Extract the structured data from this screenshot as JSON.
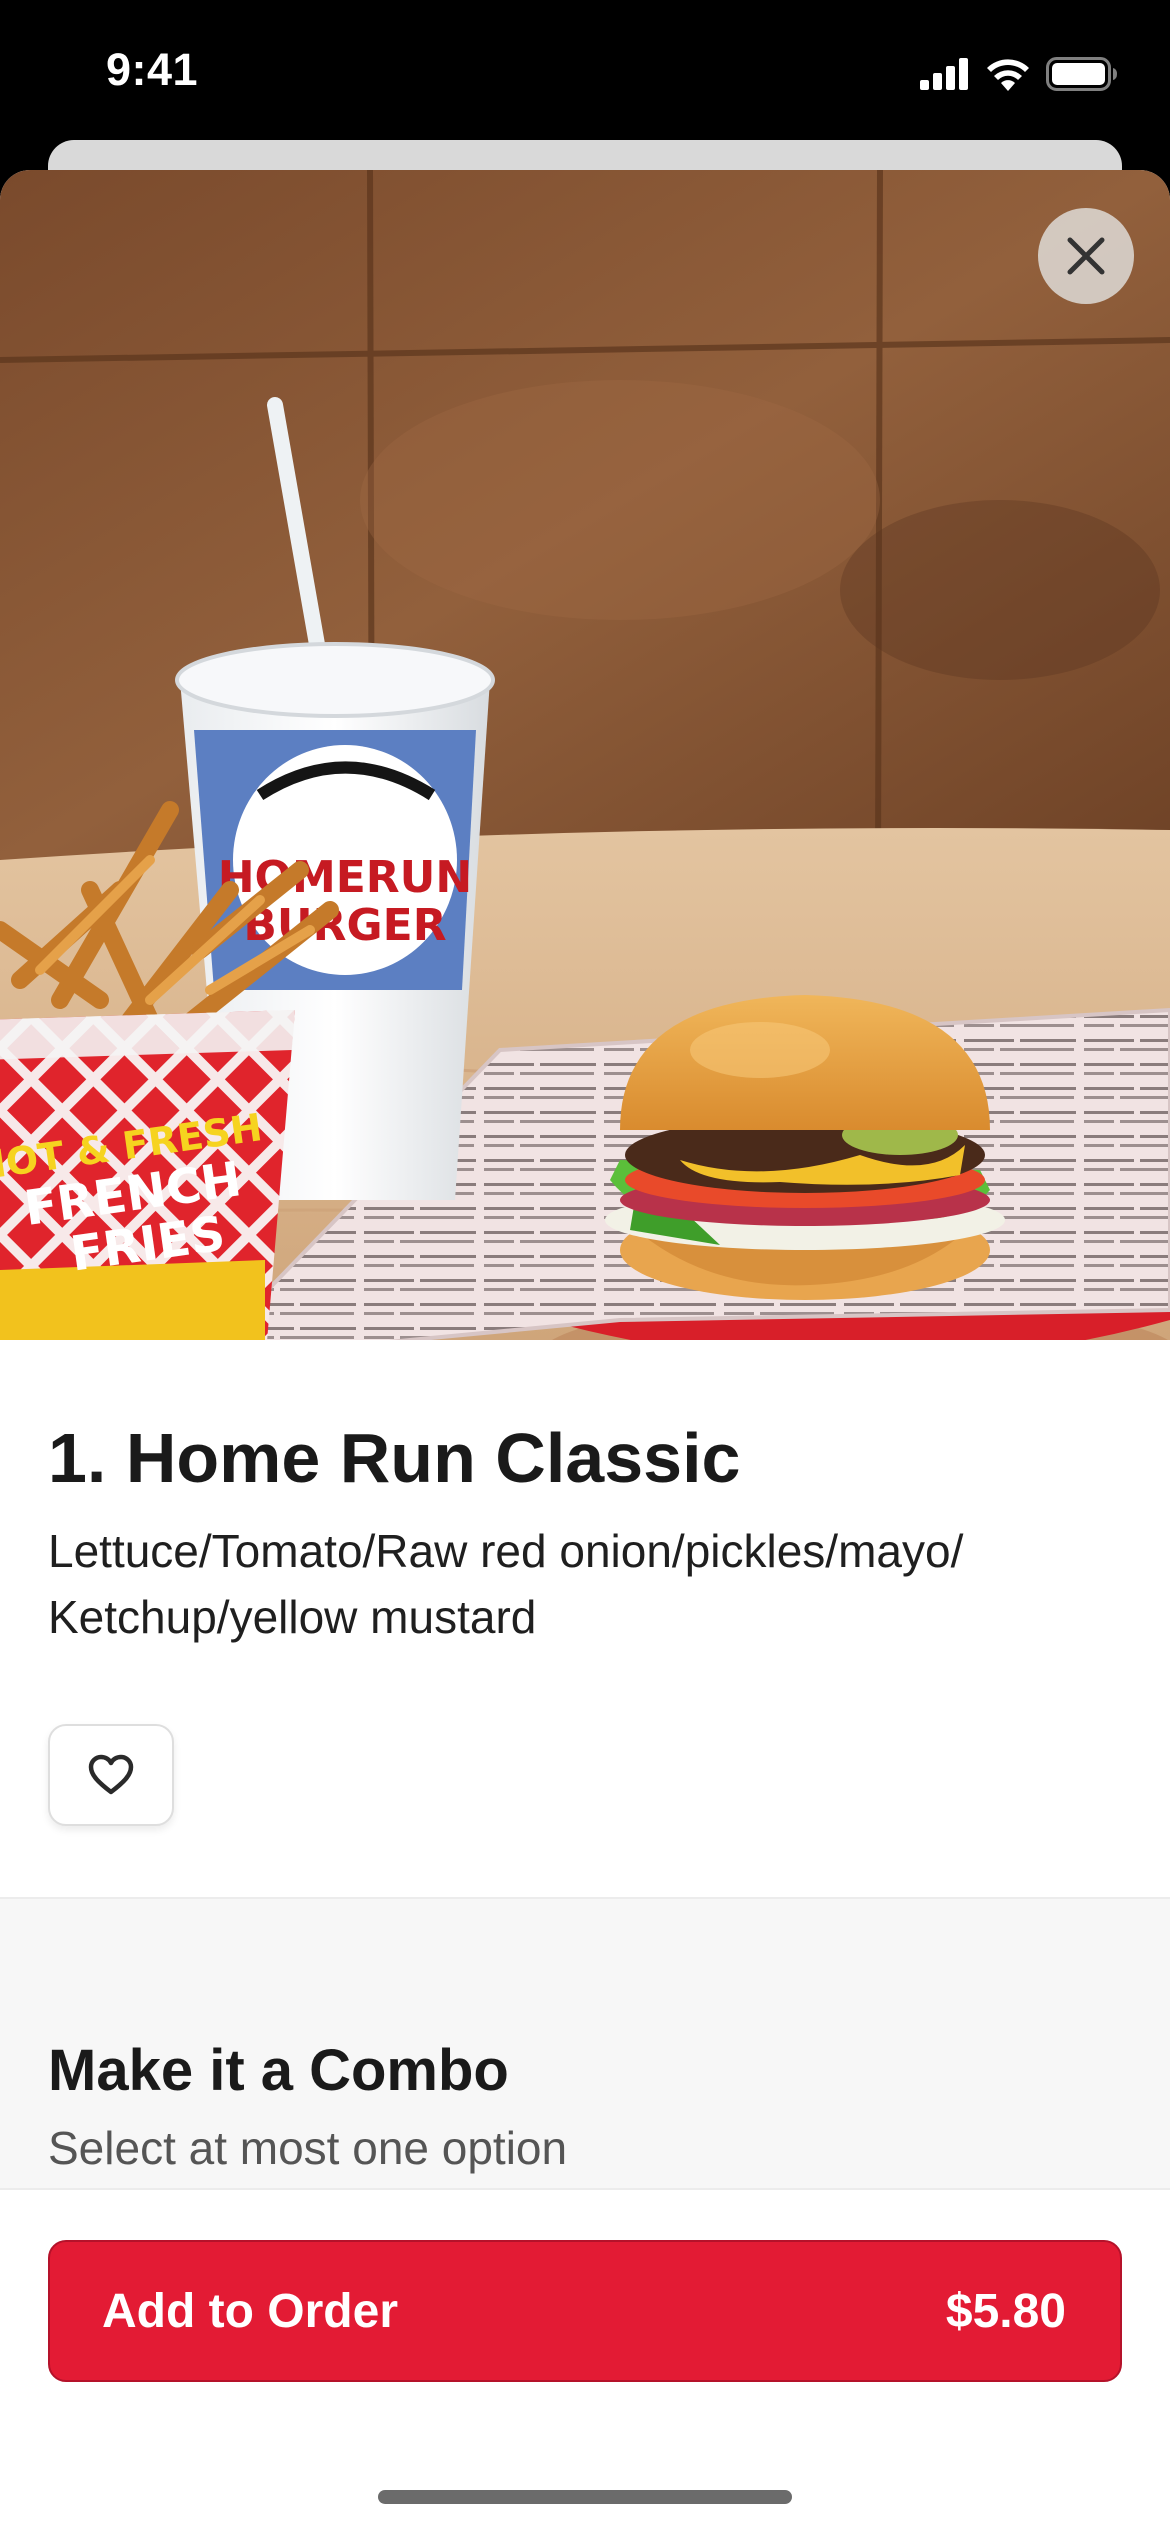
{
  "status_bar": {
    "time": "9:41",
    "icons": [
      "signal-icon",
      "wifi-icon",
      "battery-icon"
    ]
  },
  "item": {
    "title": "1. Home Run Classic",
    "description_line1": "Lettuce/Tomato/Raw red onion/pickles/mayo/",
    "description_line2": "Ketchup/yellow mustard",
    "photo_text": {
      "cup_brand_line1": "HOMERUN",
      "cup_brand_line2": "BURGER",
      "fries_line1": "HOT & FRESH",
      "fries_line2": "FRENCH",
      "fries_line3": "FRIES"
    }
  },
  "combo": {
    "title": "Make it a Combo",
    "subtitle": "Select at most one option"
  },
  "footer": {
    "add_label": "Add to Order",
    "price": "$5.80"
  },
  "colors": {
    "accent": "#e31b34",
    "text_primary": "#1a1a1a",
    "text_secondary": "#555555",
    "section_bg": "#f7f7f7"
  }
}
